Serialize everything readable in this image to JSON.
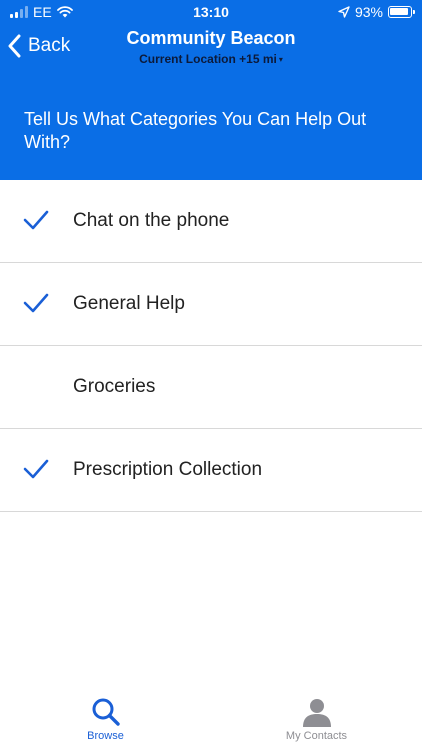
{
  "status_bar": {
    "carrier": "EE",
    "time": "13:10",
    "battery_percent": "93%",
    "battery_level": 0.93,
    "icons": [
      "signal-icon",
      "wifi-icon",
      "location-arrow-icon",
      "battery-icon"
    ]
  },
  "nav": {
    "back_label": "Back",
    "title": "Community Beacon",
    "subtitle": "Current Location +15 mi"
  },
  "prompt": "Tell Us What Categories You Can Help Out With?",
  "categories": [
    {
      "label": "Chat on the phone",
      "checked": true
    },
    {
      "label": "General Help",
      "checked": true
    },
    {
      "label": "Groceries",
      "checked": false
    },
    {
      "label": "Prescription Collection",
      "checked": true
    }
  ],
  "tabs": [
    {
      "label": "Browse",
      "icon": "search-icon",
      "active": true
    },
    {
      "label": "My Contacts",
      "icon": "person-icon",
      "active": false
    }
  ],
  "colors": {
    "header_bg": "#0a6ee6",
    "accent": "#1a5fd6",
    "inactive": "#8e8e93"
  }
}
